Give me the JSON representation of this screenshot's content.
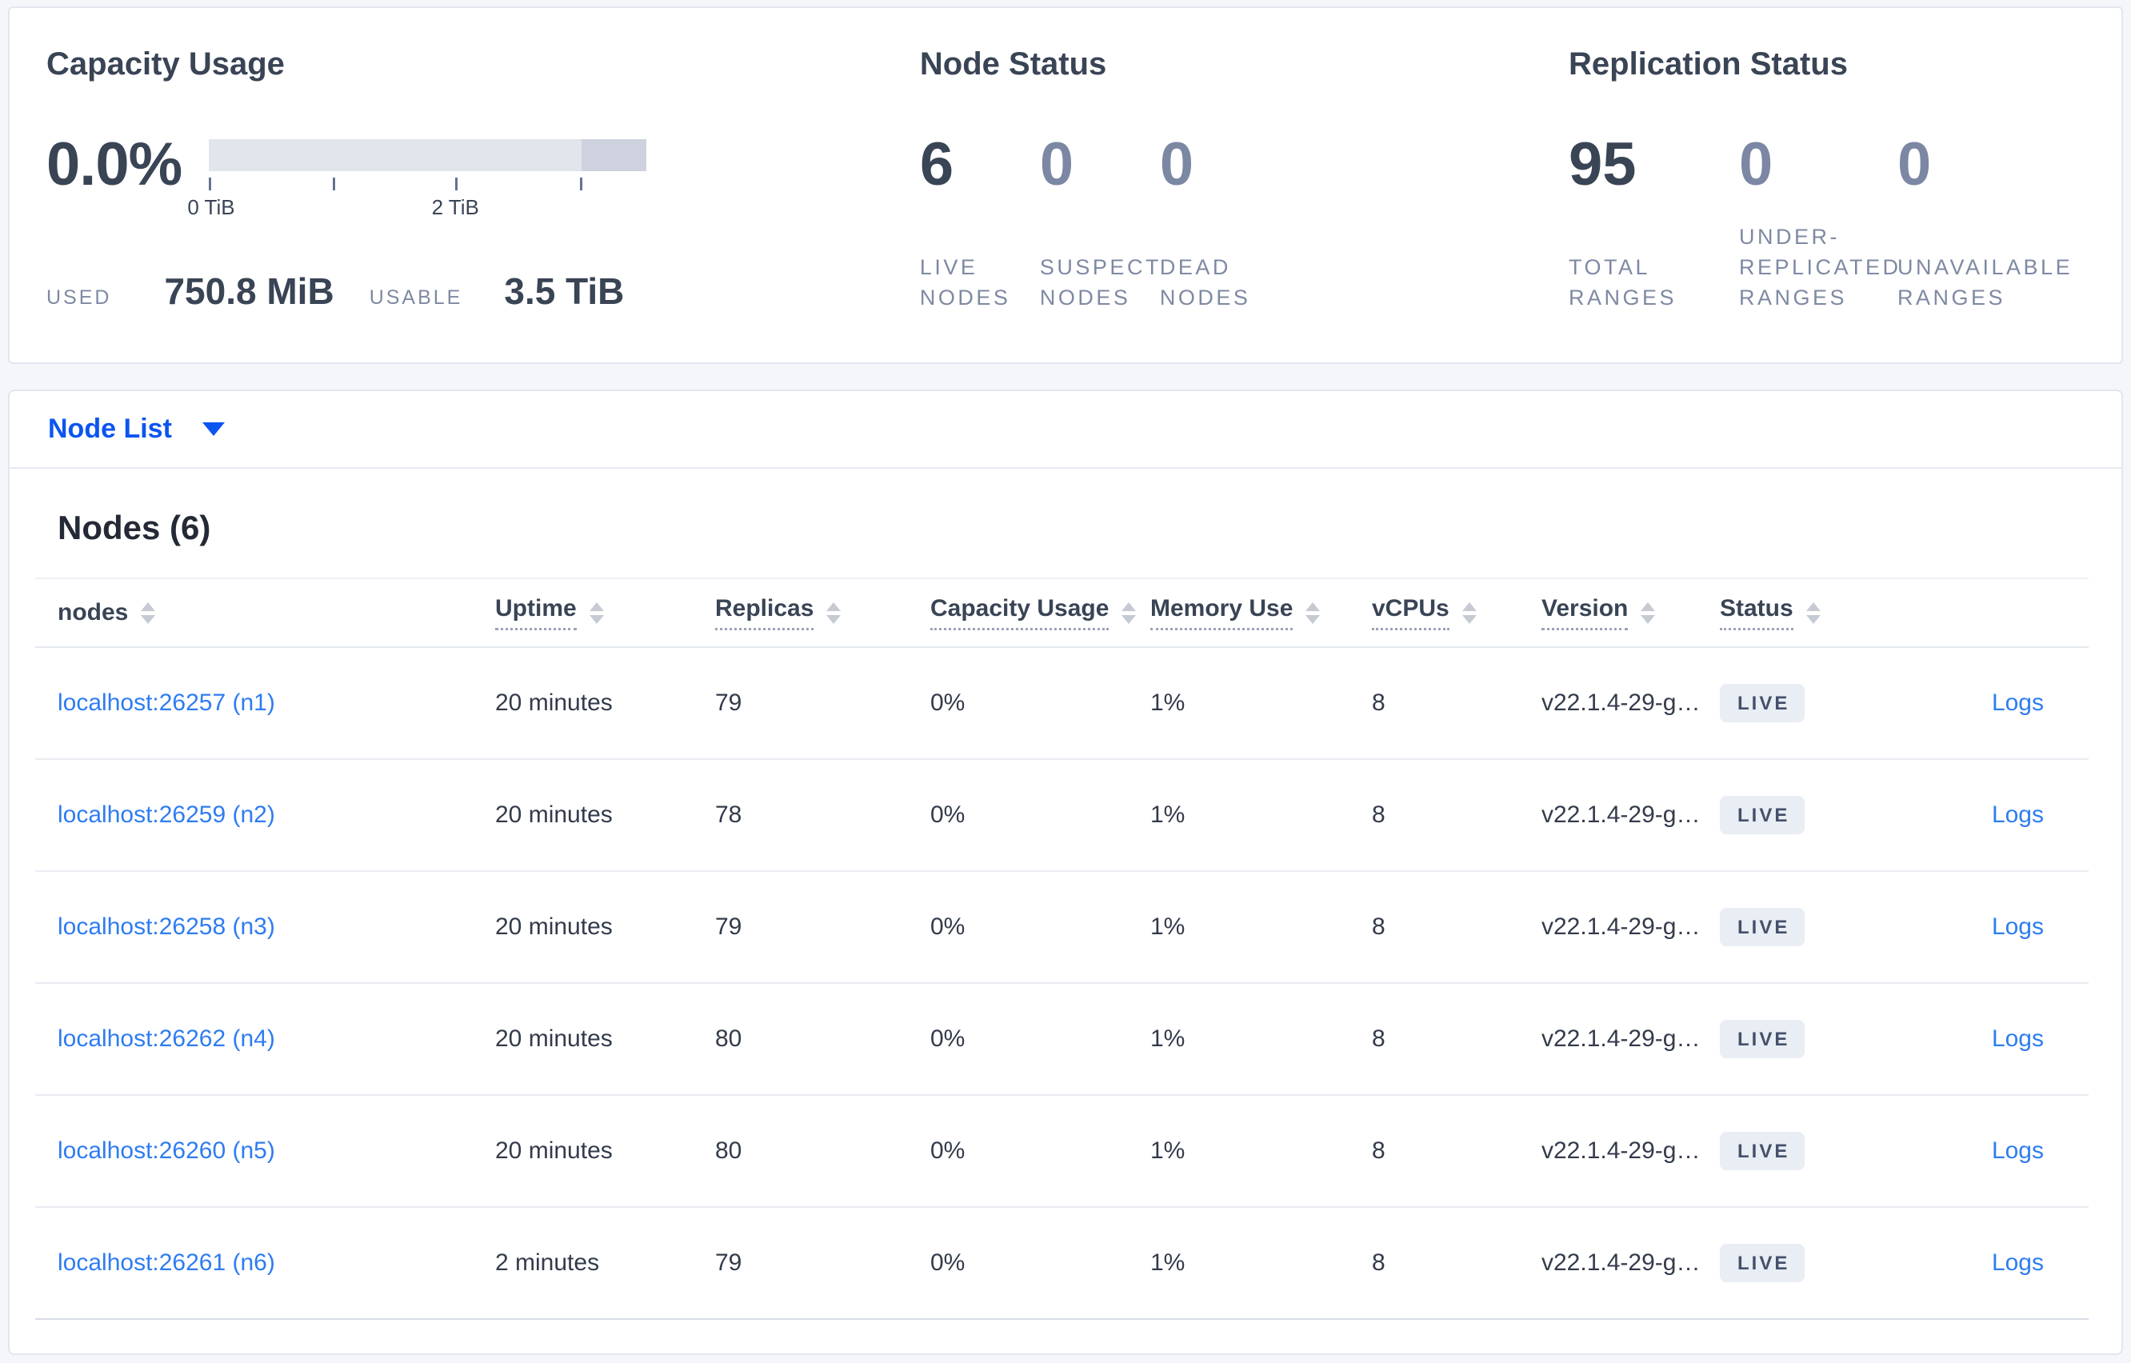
{
  "summary": {
    "capacity": {
      "title": "Capacity Usage",
      "percent": "0.0%",
      "tick_labels": [
        "0 TiB",
        "2 TiB"
      ],
      "used_label": "USED",
      "used_value": "750.8 MiB",
      "usable_label": "USABLE",
      "usable_value": "3.5 TiB"
    },
    "node_status": {
      "title": "Node Status",
      "stats": [
        {
          "value": "6",
          "label": "LIVE NODES"
        },
        {
          "value": "0",
          "label": "SUSPECT NODES"
        },
        {
          "value": "0",
          "label": "DEAD NODES"
        }
      ]
    },
    "replication": {
      "title": "Replication Status",
      "stats": [
        {
          "value": "95",
          "label": "TOTAL RANGES"
        },
        {
          "value": "0",
          "label": "UNDER-REPLICATED RANGES"
        },
        {
          "value": "0",
          "label": "UNAVAILABLE RANGES"
        }
      ]
    }
  },
  "node_list": {
    "label": "Node List"
  },
  "nodes_table": {
    "heading": "Nodes (6)",
    "columns": [
      {
        "label": "nodes"
      },
      {
        "label": "Uptime"
      },
      {
        "label": "Replicas"
      },
      {
        "label": "Capacity Usage"
      },
      {
        "label": "Memory Use"
      },
      {
        "label": "vCPUs"
      },
      {
        "label": "Version"
      },
      {
        "label": "Status"
      }
    ],
    "logs_label": "Logs",
    "rows": [
      {
        "node": "localhost:26257 (n1)",
        "uptime": "20 minutes",
        "replicas": "79",
        "capacity": "0%",
        "memory": "1%",
        "vcpus": "8",
        "version": "v22.1.4-29-g…",
        "status": "LIVE"
      },
      {
        "node": "localhost:26259 (n2)",
        "uptime": "20 minutes",
        "replicas": "78",
        "capacity": "0%",
        "memory": "1%",
        "vcpus": "8",
        "version": "v22.1.4-29-g…",
        "status": "LIVE"
      },
      {
        "node": "localhost:26258 (n3)",
        "uptime": "20 minutes",
        "replicas": "79",
        "capacity": "0%",
        "memory": "1%",
        "vcpus": "8",
        "version": "v22.1.4-29-g…",
        "status": "LIVE"
      },
      {
        "node": "localhost:26262 (n4)",
        "uptime": "20 minutes",
        "replicas": "80",
        "capacity": "0%",
        "memory": "1%",
        "vcpus": "8",
        "version": "v22.1.4-29-g…",
        "status": "LIVE"
      },
      {
        "node": "localhost:26260 (n5)",
        "uptime": "20 minutes",
        "replicas": "80",
        "capacity": "0%",
        "memory": "1%",
        "vcpus": "8",
        "version": "v22.1.4-29-g…",
        "status": "LIVE"
      },
      {
        "node": "localhost:26261 (n6)",
        "uptime": "2 minutes",
        "replicas": "79",
        "capacity": "0%",
        "memory": "1%",
        "vcpus": "8",
        "version": "v22.1.4-29-g…",
        "status": "LIVE"
      }
    ]
  },
  "colors": {
    "link_blue": "#2e7cf2",
    "primary_blue": "#0b55f0",
    "dark_slate": "#394455",
    "muted_slate": "#7b87a3",
    "badge_bg": "#e9edf4",
    "bar_light": "#e2e5ec",
    "bar_dark": "#cdd2de",
    "page_bg": "#f4f6fa"
  }
}
